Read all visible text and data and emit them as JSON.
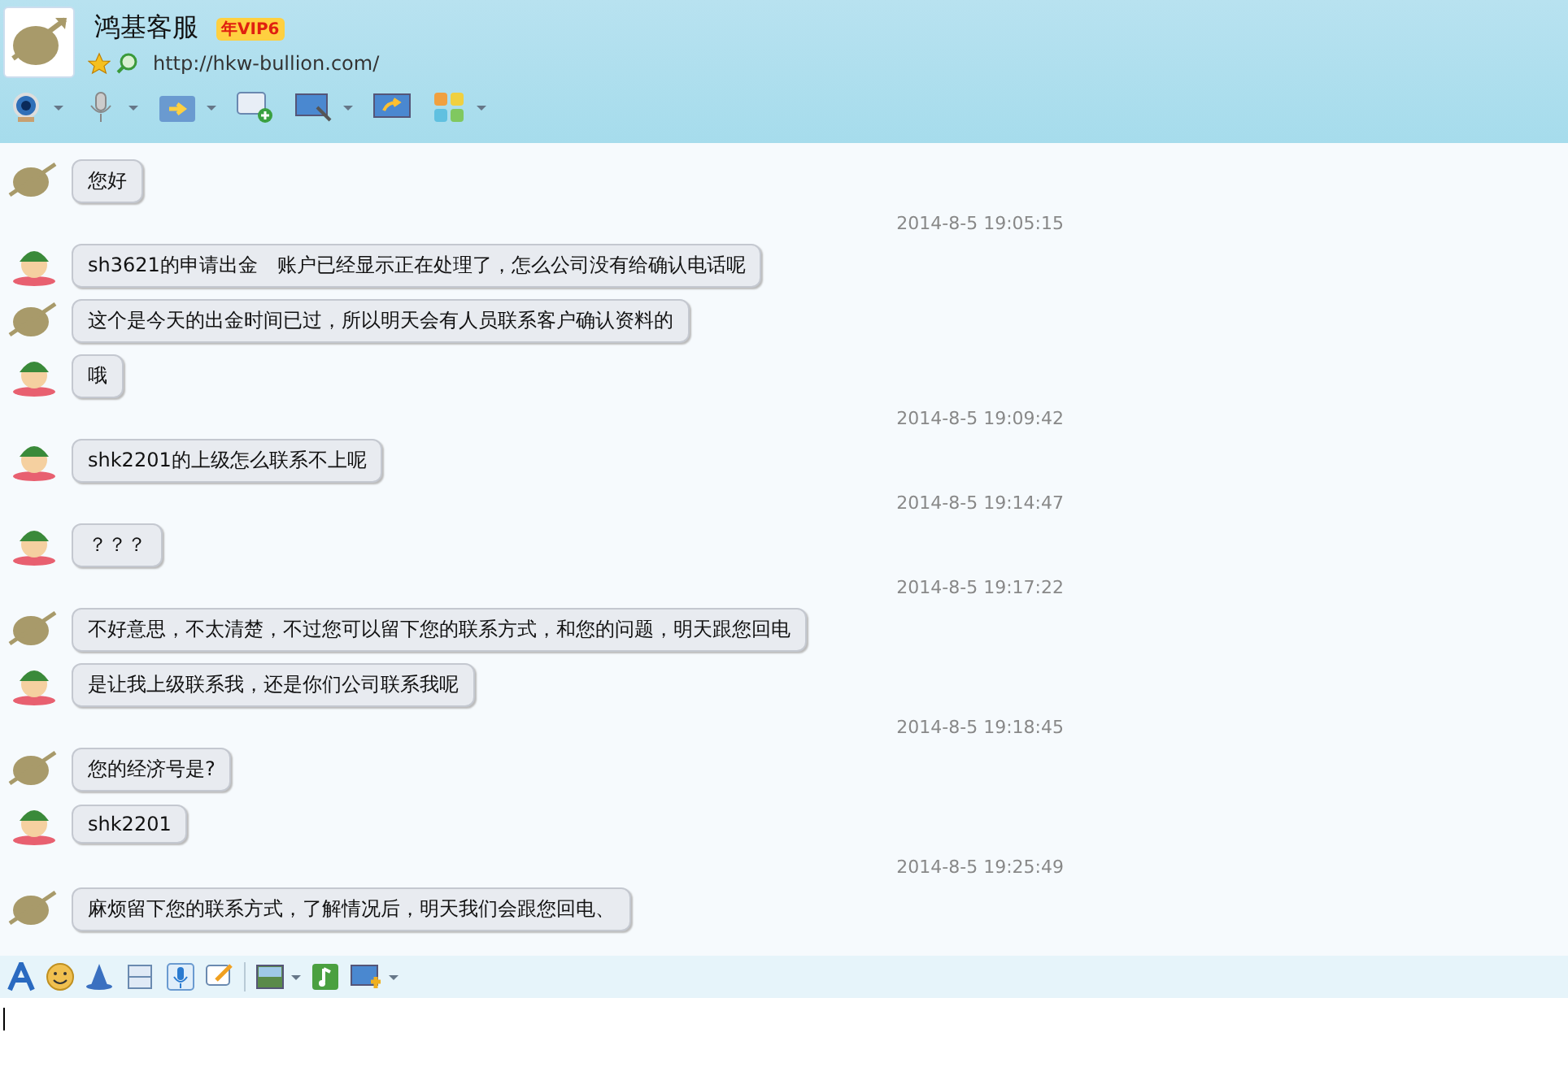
{
  "header": {
    "title": "鸿基客服",
    "vip_badge": "年VIP6",
    "url": "http://hkw-bullion.com/"
  },
  "messages": [
    {
      "kind": "agent",
      "text": "您好"
    },
    {
      "kind": "time",
      "text": "2014-8-5 19:05:15"
    },
    {
      "kind": "customer",
      "text": "sh3621的申请出金　账户已经显示正在处理了，怎么公司没有给确认电话呢"
    },
    {
      "kind": "agent",
      "text": "这个是今天的出金时间已过，所以明天会有人员联系客户确认资料的"
    },
    {
      "kind": "customer",
      "text": "哦"
    },
    {
      "kind": "time",
      "text": "2014-8-5 19:09:42"
    },
    {
      "kind": "customer",
      "text": "shk2201的上级怎么联系不上呢"
    },
    {
      "kind": "time",
      "text": "2014-8-5 19:14:47"
    },
    {
      "kind": "customer",
      "text": "？？？"
    },
    {
      "kind": "time",
      "text": "2014-8-5 19:17:22"
    },
    {
      "kind": "agent",
      "text": "不好意思，不太清楚，不过您可以留下您的联系方式，和您的问题，明天跟您回电"
    },
    {
      "kind": "customer",
      "text": "是让我上级联系我，还是你们公司联系我呢"
    },
    {
      "kind": "time",
      "text": "2014-8-5 19:18:45"
    },
    {
      "kind": "agent",
      "text": "您的经济号是?"
    },
    {
      "kind": "customer",
      "text": "shk2201"
    },
    {
      "kind": "time",
      "text": "2014-8-5 19:25:49"
    },
    {
      "kind": "agent",
      "text": "麻烦留下您的联系方式，了解情况后，明天我们会跟您回电、"
    }
  ]
}
